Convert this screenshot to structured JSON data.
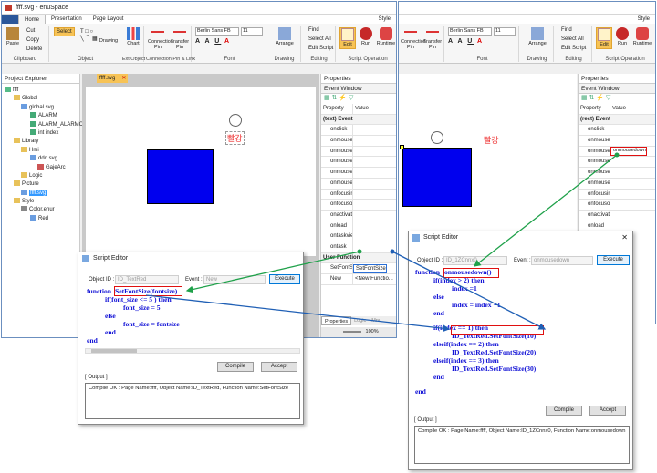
{
  "app": {
    "title": "ffff.svg - enuSpace",
    "file_tab": "ffff.svg",
    "ribbon_tabs": [
      "Home",
      "Presentation",
      "Page Layout"
    ],
    "style_label": "Style",
    "font_name": "Berlin Sans FB",
    "font_size": "11",
    "groups": [
      "Clipboard",
      "Object",
      "Ext Object",
      "Connection Pin & Link",
      "Font",
      "Drawing",
      "Editing",
      "Script Operation",
      "Runtime"
    ],
    "buttons": {
      "paste": "Paste",
      "cut": "Cut",
      "copy": "Copy",
      "delete": "Delete",
      "select": "Select",
      "drawing": "Drawing",
      "chart": "Chart",
      "connection_pin": "Connection Pin",
      "transfer_pin": "Transfer Pin",
      "arrange": "Arrange",
      "find": "Find",
      "select_all": "Select All",
      "edit_script": "Edit Script",
      "edit": "Edit",
      "run": "Run",
      "runtime": "Runtime"
    }
  },
  "project_explorer": {
    "title": "Project Explorer",
    "items": [
      "ffff",
      "Global",
      "global.svg",
      "ALARM",
      "ALARM_ALARMOO",
      "int index",
      "Library",
      "Hmi",
      "ddd.svg",
      "GajeArc",
      "Logic",
      "Picture",
      "ffff.svg",
      "Style",
      "Color.enur",
      "Red"
    ]
  },
  "canvas": {
    "label_left": "빨강",
    "label_right": "빨강",
    "rect_color": "#0000ee"
  },
  "properties_left": {
    "title": "Properties",
    "event_window": "Event Window",
    "col_property": "Property",
    "col_value": "Value",
    "category": "(text) Event",
    "events": [
      "onclick",
      "onmouseo...",
      "onmouseo...",
      "onmouseu...",
      "onmouseu...",
      "onmouseu...",
      "onfocusin",
      "onfocusout",
      "onactivate",
      "onload",
      "ontaskview",
      "ontask"
    ],
    "user_function": "User Function",
    "uf_row1_name": "SetFontSize",
    "uf_row1_value": "SetFontSize",
    "uf_row2_name": "New",
    "uf_row2_value": "<New Functio...",
    "bottom_tabs": [
      "Properties",
      "Logic",
      "Mnu"
    ],
    "zoom": "100%"
  },
  "properties_right": {
    "title": "Properties",
    "event_window": "Event Window",
    "col_property": "Property",
    "col_value": "Value",
    "category": "(rect) Event",
    "events": [
      "onclick",
      "onmouseo...",
      "onmouseo...",
      "onmouseu...",
      "onmouseu...",
      "onmouseu...",
      "onfocusin",
      "onfocusout",
      "onactivate",
      "onload",
      "ontaskview"
    ],
    "highlight_value": "onmousedown"
  },
  "dialog_left": {
    "title": "Script Editor",
    "object_id_label": "Object ID :",
    "object_id": "ID_TextRed",
    "event_label": "Event :",
    "event_value": "New",
    "execute": "Execute",
    "code": [
      [
        "kw",
        "function "
      ],
      [
        "fnh",
        "SetFontSize(fontsize)"
      ],
      [
        "nl",
        ""
      ],
      [
        "i1",
        "if(font_size <= 5 ) then"
      ],
      [
        "i2",
        "font_size = 5"
      ],
      [
        "i1k",
        "else"
      ],
      [
        "i2",
        "font_size = fontsize"
      ],
      [
        "i1k",
        "end"
      ],
      [
        "k",
        "end"
      ]
    ],
    "compile": "Compile",
    "accept": "Accept",
    "output_label": "[ Output ]",
    "output": "Compile OK : Page Name:ffff, Object Name:ID_TextRed, Function Name:SetFontSize"
  },
  "dialog_right": {
    "title": "Script Editor",
    "object_id_label": "Object ID :",
    "object_id": "ID_1ZCnnx0",
    "event_label": "Event :",
    "event_value": "onmousedown",
    "execute": "Execute",
    "code_fn": "function ",
    "code_fnname": "onmousedown()",
    "code_lines": [
      "if(index > 2) then",
      "index =1",
      "else",
      "index = index +1",
      "end",
      "",
      "if(index == 1) then",
      "ID_TextRed.SetFontSize(10)",
      "elseif(index == 2) then",
      "ID_TextRed.SetFontSize(20)",
      "elseif(index == 3) then",
      "ID_TextRed.SetFontSize(30)",
      "end",
      "",
      "end"
    ],
    "compile": "Compile",
    "accept": "Accept",
    "output_label": "[ Output ]",
    "output": "Compile OK : Page Name:ffff, Object Name:ID_1ZCnnx0, Function Name:onmousedown"
  },
  "colors": {
    "accent_green": "#1fa14a",
    "accent_blue": "#1f5fb5",
    "highlight_red": "#e01010",
    "keyword_blue": "#1212d6"
  }
}
